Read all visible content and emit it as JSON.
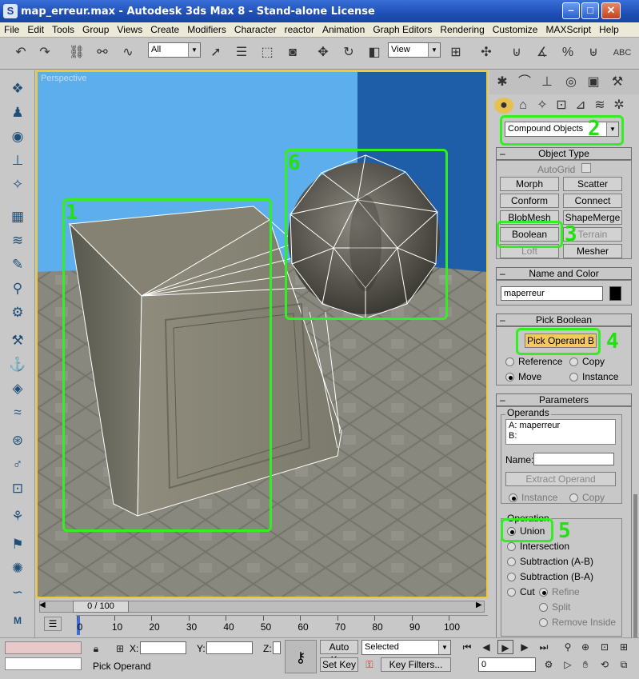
{
  "window": {
    "title": "map_erreur.max - Autodesk 3ds Max 8  - Stand-alone License",
    "app_icon": "max-logo-icon"
  },
  "menu": [
    "File",
    "Edit",
    "Tools",
    "Group",
    "Views",
    "Create",
    "Modifiers",
    "Character",
    "reactor",
    "Animation",
    "Graph Editors",
    "Rendering",
    "Customize",
    "MAXScript",
    "Help"
  ],
  "toolbar": {
    "selection_filter": "All",
    "ref_coord": "View"
  },
  "viewport": {
    "label": "Perspective"
  },
  "command_panel": {
    "category": "Compound Objects",
    "object_type": {
      "title": "Object Type",
      "autogrid": "AutoGrid",
      "buttons": [
        "Morph",
        "Scatter",
        "Conform",
        "Connect",
        "BlobMesh",
        "ShapeMerge",
        "Boolean",
        "Terrain",
        "Loft",
        "Mesher"
      ]
    },
    "name_color": {
      "title": "Name and Color",
      "name": "maperreur",
      "swatch": "#000000"
    },
    "pick_boolean": {
      "title": "Pick Boolean",
      "pick_button": "Pick Operand B",
      "options": [
        "Reference",
        "Copy",
        "Move",
        "Instance"
      ],
      "selected": "Move"
    },
    "parameters": {
      "title": "Parameters",
      "operands_label": "Operands",
      "operands": [
        "A: maperreur",
        "B:"
      ],
      "name_label": "Name:",
      "extract_button": "Extract Operand",
      "extract_options": [
        "Instance",
        "Copy"
      ],
      "operation_label": "Operation",
      "operations": [
        "Union",
        "Intersection",
        "Subtraction (A-B)",
        "Subtraction (B-A)",
        "Cut"
      ],
      "selected_operation": "Union",
      "cut_options": [
        "Refine",
        "Split",
        "Remove Inside"
      ]
    }
  },
  "callouts": [
    "1",
    "2",
    "3",
    "4",
    "5",
    "6"
  ],
  "timeline": {
    "frame": "0 / 100",
    "ticks": [
      "0",
      "10",
      "20",
      "30",
      "40",
      "50",
      "60",
      "70",
      "80",
      "90",
      "100"
    ]
  },
  "status": {
    "x_label": "X:",
    "y_label": "Y:",
    "z_label": "Z:",
    "prompt": "Pick Operand",
    "auto_key": "Auto Key",
    "set_key": "Set Key",
    "key_mode": "Selected",
    "key_filters": "Key Filters...",
    "frame_value": "0"
  },
  "colors": {
    "selection_highlight": "#33ee22",
    "pick_active": "#f5c860",
    "viewport_border": "#f0c830"
  }
}
